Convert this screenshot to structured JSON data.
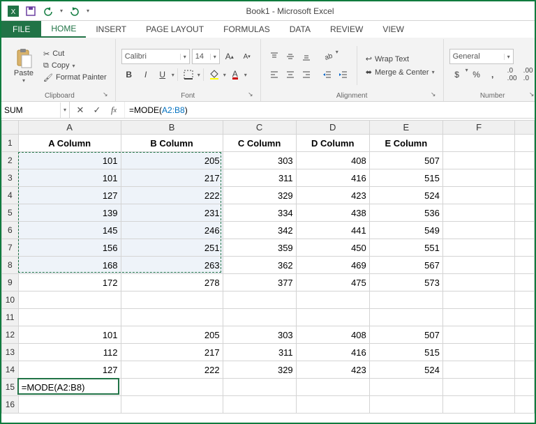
{
  "title": "Book1 - Microsoft Excel",
  "qat": {
    "save": "save-icon",
    "undo": "undo-icon",
    "redo": "redo-icon"
  },
  "tabs": {
    "file": "FILE",
    "items": [
      "HOME",
      "INSERT",
      "PAGE LAYOUT",
      "FORMULAS",
      "DATA",
      "REVIEW",
      "VIEW"
    ],
    "active": "HOME"
  },
  "ribbon": {
    "clipboard": {
      "paste": "Paste",
      "cut": "Cut",
      "copy": "Copy",
      "format_painter": "Format Painter",
      "label": "Clipboard"
    },
    "font": {
      "name": "Calibri",
      "size": "14",
      "label": "Font"
    },
    "alignment": {
      "wrap": "Wrap Text",
      "merge": "Merge & Center",
      "label": "Alignment"
    },
    "number": {
      "format": "General",
      "label": "Number"
    }
  },
  "formula_bar": {
    "name_box": "SUM",
    "prefix": "=MODE(",
    "ref": "A2:B8",
    "suffix": ")"
  },
  "headers": [
    "A Column",
    "B Column",
    "C Column",
    "D Column",
    "E Column"
  ],
  "rows": {
    "2": [
      101,
      205,
      303,
      408,
      507
    ],
    "3": [
      101,
      217,
      311,
      416,
      515
    ],
    "4": [
      127,
      222,
      329,
      423,
      524
    ],
    "5": [
      139,
      231,
      334,
      438,
      536
    ],
    "6": [
      145,
      246,
      342,
      441,
      549
    ],
    "7": [
      156,
      251,
      359,
      450,
      551
    ],
    "8": [
      168,
      263,
      362,
      469,
      567
    ],
    "9": [
      172,
      278,
      377,
      475,
      573
    ],
    "12": [
      101,
      205,
      303,
      408,
      507
    ],
    "13": [
      112,
      217,
      311,
      416,
      515
    ],
    "14": [
      127,
      222,
      329,
      423,
      524
    ]
  },
  "row15_formula": "=MODE(A2:B8)",
  "selection": {
    "range": "A2:B8",
    "active_cell": "A15"
  }
}
